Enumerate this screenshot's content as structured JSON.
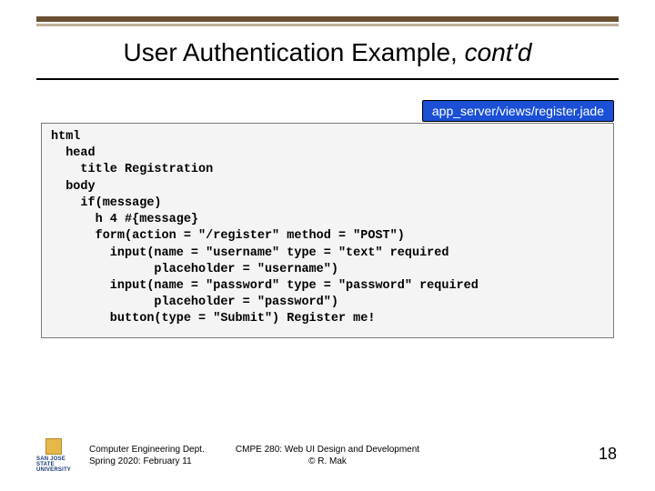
{
  "title_main": "User Authentication Example, ",
  "title_ital": "cont'd",
  "file_badge": "app_server/views/register.jade",
  "code": "html\n  head\n    title Registration\n  body\n    if(message)\n      h 4 #{message}\n      form(action = \"/register\" method = \"POST\")\n        input(name = \"username\" type = \"text\" required\n              placeholder = \"username\")\n        input(name = \"password\" type = \"password\" required\n              placeholder = \"password\")\n        button(type = \"Submit\") Register me!",
  "logo_text": "SAN JOSE STATE\nUNIVERSITY",
  "footer_left_line1": "Computer Engineering Dept.",
  "footer_left_line2": "Spring 2020: February 11",
  "footer_center_line1": "CMPE 280: Web UI Design and Development",
  "footer_center_line2": "© R. Mak",
  "page_number": "18"
}
